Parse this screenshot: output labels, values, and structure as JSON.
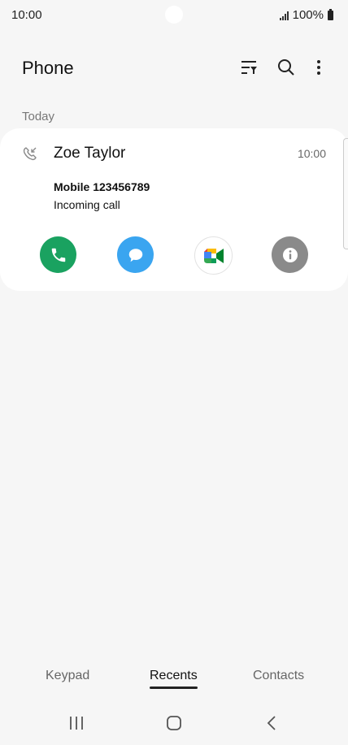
{
  "status_bar": {
    "time": "10:00",
    "battery": "100%"
  },
  "app_bar": {
    "title": "Phone"
  },
  "section": {
    "header": "Today"
  },
  "call": {
    "name": "Zoe Taylor",
    "time": "10:00",
    "number": "Mobile 123456789",
    "status": "Incoming call"
  },
  "actions": {
    "call_icon": "phone-icon",
    "message_icon": "message-icon",
    "video_icon": "video-call-icon",
    "info_icon": "info-icon"
  },
  "tabs": {
    "keypad": "Keypad",
    "recents": "Recents",
    "contacts": "Contacts"
  },
  "colors": {
    "call_green": "#1aa260",
    "message_blue": "#3aa5f0",
    "info_gray": "#8a8a8a"
  }
}
